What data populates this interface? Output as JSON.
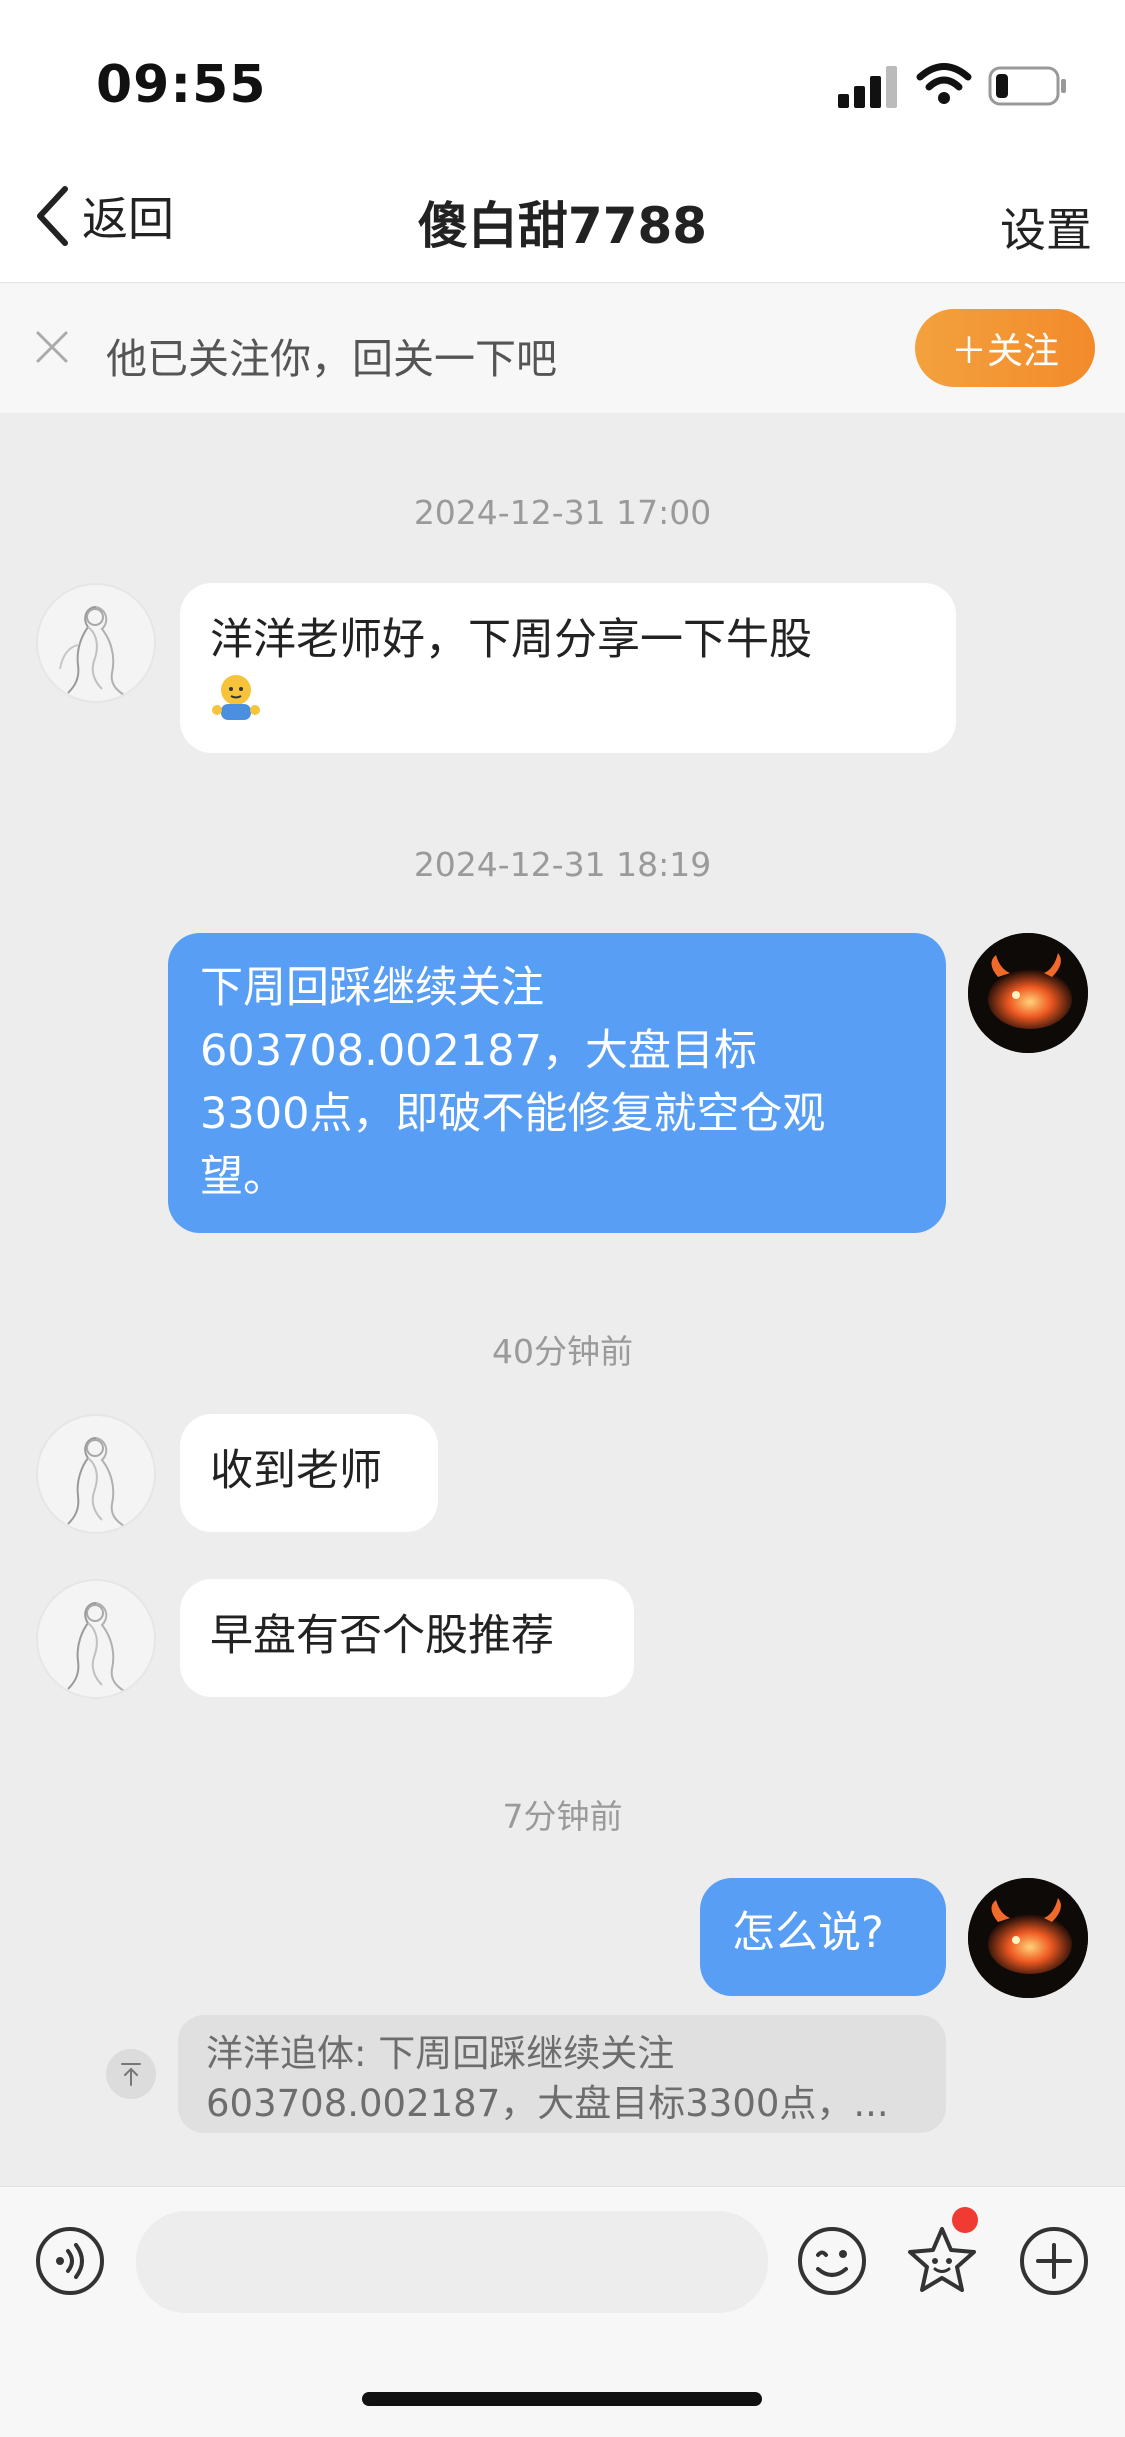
{
  "status_bar": {
    "time": "09:55"
  },
  "nav": {
    "back_label": "返回",
    "title": "傻白甜7788",
    "settings_label": "设置"
  },
  "follow_banner": {
    "text": "他已关注你，回关一下吧",
    "button_label": "＋关注"
  },
  "messages": [
    {
      "type": "timestamp",
      "text": "2024-12-31 17:00"
    },
    {
      "type": "incoming",
      "text": "洋洋老师好，下周分享一下牛股",
      "emoji": "bear-emoji"
    },
    {
      "type": "timestamp",
      "text": "2024-12-31 18:19"
    },
    {
      "type": "outgoing",
      "lines": [
        "下周回踩继续关注",
        "603708.002187，大盘目标",
        "3300点，即破不能修复就空仓观",
        "望。"
      ]
    },
    {
      "type": "timestamp",
      "text": "40分钟前"
    },
    {
      "type": "incoming",
      "text": "收到老师"
    },
    {
      "type": "incoming",
      "text": "早盘有否个股推荐"
    },
    {
      "type": "timestamp",
      "text": "7分钟前"
    },
    {
      "type": "outgoing",
      "text": "怎么说?"
    }
  ],
  "quoted_reply": {
    "line1": "洋洋追体: 下周回踩继续关注",
    "line2": "603708.002187，大盘目标3300点，..."
  },
  "input": {
    "placeholder": ""
  },
  "icons": {
    "voice": "voice-icon",
    "emoji": "smile-icon",
    "favorite": "star-icon",
    "plus": "plus-icon"
  },
  "colors": {
    "outgoing_bubble": "#589ef5",
    "follow_button": "#f3a13e",
    "badge_dot": "#f13a31",
    "background": "#ededed"
  }
}
